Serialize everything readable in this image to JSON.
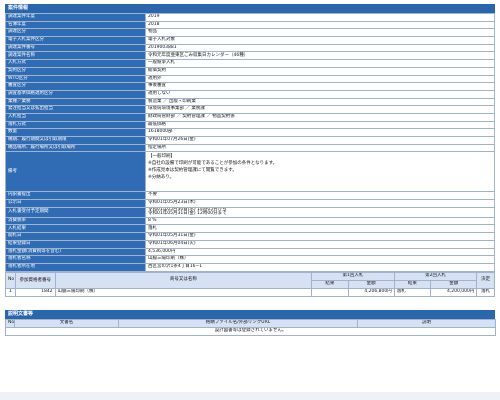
{
  "section_title": "案件情報",
  "info": [
    {
      "k": "調達案件年度",
      "v": "2019"
    },
    {
      "k": "名簿年度",
      "v": "2018"
    },
    {
      "k": "調達区分",
      "v": "物品"
    },
    {
      "k": "電子入札案件区分",
      "v": "電子入札対象"
    },
    {
      "k": "調達案件番号",
      "v": "20190038​81"
    },
    {
      "k": "調達案件名称",
      "v": "令和元年度亜東区ごみ収集日カレンダー（46種）"
    },
    {
      "k": "入札方式",
      "v": "一般競争入札"
    },
    {
      "k": "契約区分",
      "v": "総価契約"
    },
    {
      "k": "WTO区分",
      "v": "適用外"
    },
    {
      "k": "審査区分",
      "v": "事後審査"
    },
    {
      "k": "調査基準価格適用区分",
      "v": "適用しない"
    },
    {
      "k": "業種／業務",
      "v": "製造業 ／ 出版・印刷業"
    },
    {
      "k": "発注担当又は払出担当",
      "v": "環境局環境事業部 ／ 業務課"
    },
    {
      "k": "入札担当",
      "v": "財政局管財部 ／ 契約管理課 ／ 物品契約係"
    },
    {
      "k": "落札方式",
      "v": "最低価格"
    },
    {
      "k": "数量",
      "v": "1618000部"
    },
    {
      "k": "納期、履行期間又は引取期限",
      "v": "令和01年07月26日(金)"
    },
    {
      "k": "納品場所、履行場所又は引取場所",
      "v": "指定場所"
    },
    {
      "k": "内訳書提出",
      "v": "不要"
    },
    {
      "k": "公示日",
      "v": "令和01年05月23日(木)"
    },
    {
      "k": "入札書受付予定期間",
      "v1": "令和01年05月30日(木) 14時05分から",
      "v2": "令和01年05月31日(金) 12時00分まで"
    },
    {
      "k": "消費税率",
      "v": "8 %"
    },
    {
      "k": "入札結果",
      "v": "落札"
    },
    {
      "k": "開札日",
      "v": "令和01年05月31日(金)"
    },
    {
      "k": "結果登録日",
      "v": "令和01年06月04日(火)"
    },
    {
      "k": "落札金額(消費税等を含む)",
      "v": "4,536,000円"
    },
    {
      "k": "落札者名称",
      "v": "山脇三陽印刷（株）"
    },
    {
      "k": "落札者所在地",
      "v": "西区宮の沢1条4丁目16−1"
    }
  ],
  "bikou": {
    "k": "備考",
    "lines": [
      "【一般印刷】",
      "※自社の設備で印刷が可能であることが参加の条件となります。",
      "※作成見本は契約管理課にて閲覧できます。",
      "※分納あり。"
    ]
  },
  "bids": {
    "headers": {
      "no": "No",
      "participant_no": "参加資格者番号",
      "name": "商号又は名称",
      "round1": "第1回入札",
      "round2": "第2回入札",
      "decision": "決定",
      "result": "結果",
      "amount": "金額"
    },
    "rows": [
      {
        "no": "1",
        "participant_no": "1842",
        "name": "山脇三陽印刷（株）",
        "r1_result": "",
        "r1_amount": "4,206,800円",
        "r2_result": "落札",
        "r2_amount": "4,200,000円",
        "decision": "落札"
      }
    ]
  },
  "docs": {
    "title": "説明文書等",
    "headers": {
      "no": "No",
      "name": "文書名",
      "file": "格納ファイル名/外部リンクURL",
      "desc": "説明"
    },
    "empty": "設計図書等は登録されていません。"
  }
}
